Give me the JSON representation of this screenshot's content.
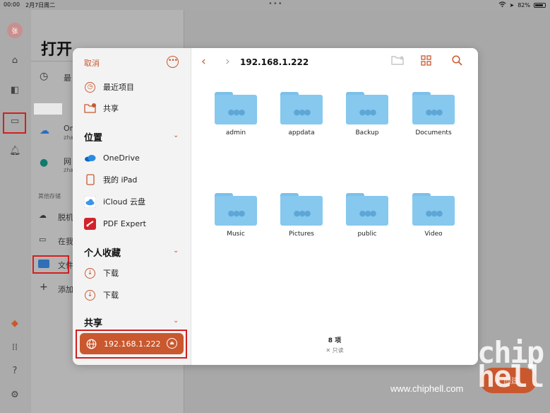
{
  "status_bar": {
    "time": "00:00",
    "date": "2月7日周二",
    "battery": "82%",
    "battery_level": 0.82
  },
  "background": {
    "avatar": "张",
    "title": "打开",
    "recent": "最",
    "onedrive_name": "On",
    "onedrive_sub": "zha",
    "sharepoint_name": "网",
    "sharepoint_sub": "zha",
    "other_storage": "其他存储",
    "offline": "脱机",
    "on_my": "在我",
    "files": "文件",
    "add": "添加",
    "create_btn": "+ 创建"
  },
  "sidebar": {
    "cancel": "取消",
    "more": "•••",
    "top_items": [
      {
        "label": "最近项目",
        "icon": "clock-icon"
      },
      {
        "label": "共享",
        "icon": "shared-folder-icon"
      }
    ],
    "locations_title": "位置",
    "locations": [
      {
        "label": "OneDrive",
        "icon": "onedrive-icon"
      },
      {
        "label": "我的 iPad",
        "icon": "ipad-icon"
      },
      {
        "label": "iCloud 云盘",
        "icon": "icloud-icon"
      },
      {
        "label": "PDF Expert",
        "icon": "pdf-expert-icon"
      }
    ],
    "favorites_title": "个人收藏",
    "favorites": [
      {
        "label": "下载",
        "icon": "download-icon"
      },
      {
        "label": "下载",
        "icon": "download-icon"
      }
    ],
    "shared_title": "共享",
    "shared_server": "192.168.1.222"
  },
  "browser": {
    "path": "192.168.1.222",
    "folders": [
      "admin",
      "appdata",
      "Backup",
      "Documents",
      "Music",
      "Pictures",
      "public",
      "Video"
    ],
    "item_count": "8 项",
    "readonly": "✕ 只读"
  },
  "watermark": {
    "logo": "chip hell",
    "url": "www.chiphell.com"
  },
  "colors": {
    "accent": "#c9582e",
    "folder": "#86c8ee",
    "highlight_red": "#d41f1f"
  }
}
